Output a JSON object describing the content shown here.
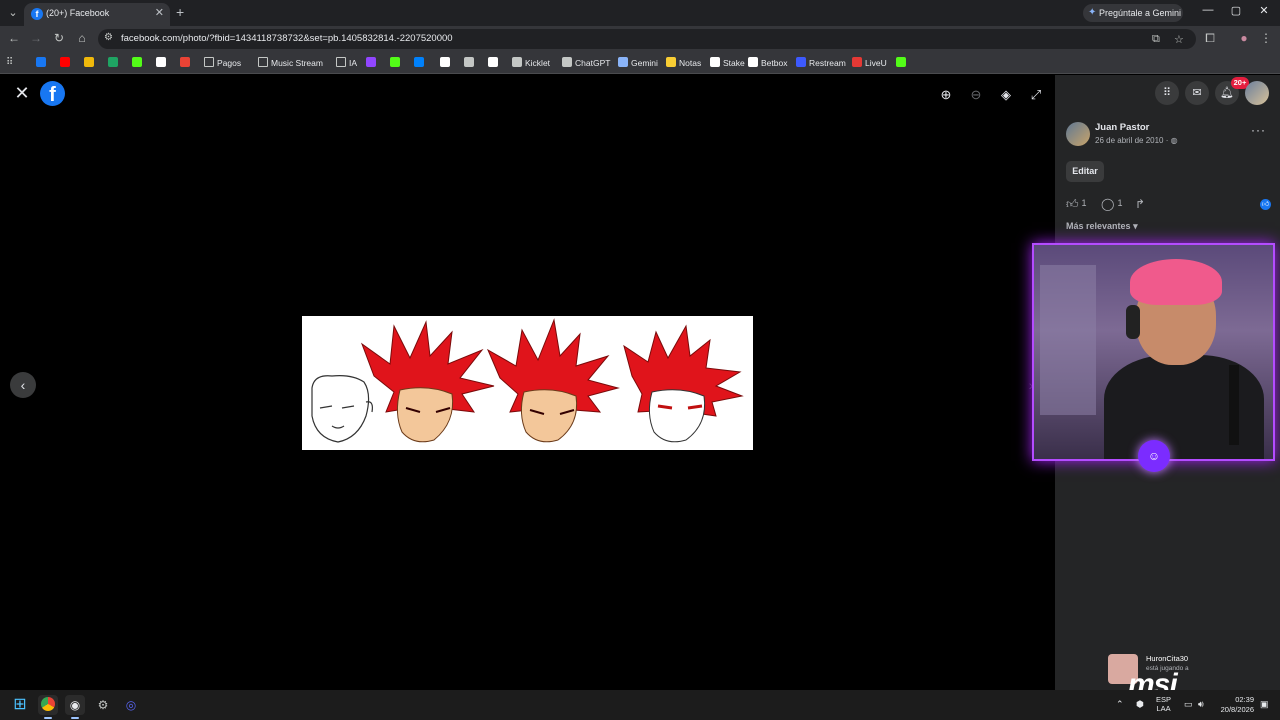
{
  "browser": {
    "tab_title": "(20+) Facebook",
    "tab_favicon": "f",
    "gemini_button": "Pregúntale a Gemini",
    "url": "facebook.com/photo/?fbid=1434118738732&set=pb.1405832814.-2207520000",
    "window_controls": [
      "—",
      "▢",
      "✕"
    ]
  },
  "bookmarks": [
    {
      "label": "",
      "icon": "facebook-icon",
      "color": "#1877f2"
    },
    {
      "label": "",
      "icon": "youtube-icon",
      "color": "#ff0000"
    },
    {
      "label": "",
      "icon": "binance-icon",
      "color": "#f0b90b"
    },
    {
      "label": "",
      "icon": "drive-icon",
      "color": "#1fa463"
    },
    {
      "label": "",
      "icon": "kick-icon",
      "color": "#53fc18"
    },
    {
      "label": "",
      "icon": "tiktok-icon",
      "color": "#ffffff"
    },
    {
      "label": "",
      "icon": "gmail-icon",
      "color": "#ea4335"
    },
    {
      "label": "Pagos",
      "icon": "folder-icon",
      "color": "#c4c7c5"
    },
    {
      "label": "Music Stream",
      "icon": "folder-icon",
      "color": "#c4c7c5"
    },
    {
      "label": "IA",
      "icon": "folder-icon",
      "color": "#c4c7c5"
    },
    {
      "label": "",
      "icon": "twitch-icon",
      "color": "#9146ff"
    },
    {
      "label": "",
      "icon": "kick-icon",
      "color": "#53fc18"
    },
    {
      "label": "",
      "icon": "meta-icon",
      "color": "#0081fb"
    },
    {
      "label": "",
      "icon": "tiktok-icon",
      "color": "#ffffff"
    },
    {
      "label": "",
      "icon": "vanguard-icon",
      "color": "#c4c7c5"
    },
    {
      "label": "",
      "icon": "diamond-icon",
      "color": "#ffffff"
    },
    {
      "label": "Kicklet",
      "icon": "kicklet-icon",
      "color": "#c4c7c5"
    },
    {
      "label": "ChatGPT",
      "icon": "chatgpt-icon",
      "color": "#c4c7c5"
    },
    {
      "label": "Gemini",
      "icon": "gemini-icon",
      "color": "#8ab4f8"
    },
    {
      "label": "Notas",
      "icon": "bulb-icon",
      "color": "#f9ce34"
    },
    {
      "label": "Stake",
      "icon": "stake-icon",
      "color": "#ffffff"
    },
    {
      "label": "Betbox",
      "icon": "betbox-icon",
      "color": "#ffffff"
    },
    {
      "label": "Restream",
      "icon": "restream-icon",
      "color": "#3d5afe"
    },
    {
      "label": "LiveU",
      "icon": "liveu-icon",
      "color": "#e53935"
    },
    {
      "label": "",
      "icon": "check-icon",
      "color": "#53fc18"
    }
  ],
  "post": {
    "author": "Juan Pastor",
    "date": "26 de abril de 2010 ·",
    "edit_label": "Editar",
    "likes": "1",
    "comments": "1",
    "sort_label": "Más relevantes"
  },
  "notifications_badge": "20+",
  "stream": {
    "username": "HuronCita30",
    "status": "está jugando a",
    "brand": "msi"
  },
  "taskbar": {
    "lang_top": "ESP",
    "lang_bottom": "LAA",
    "time": "02:39",
    "date": "20/8/2026"
  }
}
